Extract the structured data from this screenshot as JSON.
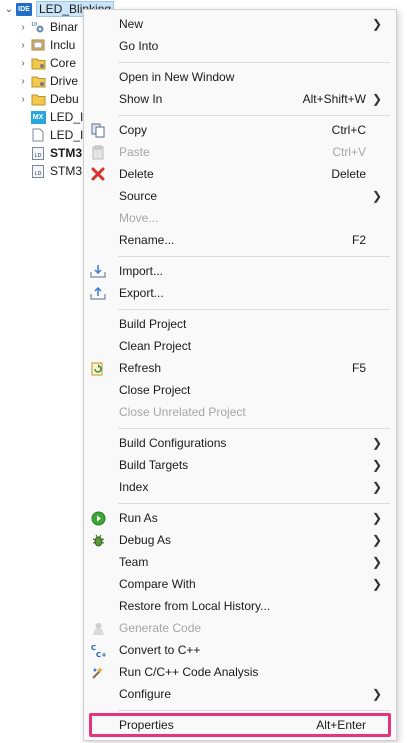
{
  "tree": {
    "items": [
      {
        "label": "LED_Blinking",
        "icon": "ide-project-icon",
        "expanded": true
      },
      {
        "label": "Binar",
        "icon": "binaries-icon"
      },
      {
        "label": "Inclu",
        "icon": "includes-icon"
      },
      {
        "label": "Core",
        "icon": "folder-icon"
      },
      {
        "label": "Drive",
        "icon": "folder-icon"
      },
      {
        "label": "Debu",
        "icon": "folder-icon"
      },
      {
        "label": "LED_I",
        "icon": "mx-file-icon"
      },
      {
        "label": "LED_I",
        "icon": "file-icon"
      },
      {
        "label": "STM3",
        "icon": "linker-file-icon"
      },
      {
        "label": "STM3",
        "icon": "linker-file-icon"
      }
    ]
  },
  "menu": {
    "items": [
      {
        "label": "New",
        "shortcut": "",
        "submenu": true
      },
      {
        "label": "Go Into",
        "shortcut": ""
      },
      {
        "label": "Open in New Window",
        "shortcut": ""
      },
      {
        "label": "Show In",
        "shortcut": "Alt+Shift+W",
        "submenu": true
      },
      {
        "label": "Copy",
        "shortcut": "Ctrl+C",
        "icon": "copy-icon"
      },
      {
        "label": "Paste",
        "shortcut": "Ctrl+V",
        "icon": "paste-icon",
        "disabled": true
      },
      {
        "label": "Delete",
        "shortcut": "Delete",
        "icon": "delete-icon"
      },
      {
        "label": "Source",
        "shortcut": "",
        "submenu": true
      },
      {
        "label": "Move...",
        "shortcut": "",
        "disabled": true
      },
      {
        "label": "Rename...",
        "shortcut": "F2"
      },
      {
        "label": "Import...",
        "shortcut": "",
        "icon": "import-icon"
      },
      {
        "label": "Export...",
        "shortcut": "",
        "icon": "export-icon"
      },
      {
        "label": "Build Project",
        "shortcut": ""
      },
      {
        "label": "Clean Project",
        "shortcut": ""
      },
      {
        "label": "Refresh",
        "shortcut": "F5",
        "icon": "refresh-icon"
      },
      {
        "label": "Close Project",
        "shortcut": ""
      },
      {
        "label": "Close Unrelated Project",
        "shortcut": "",
        "disabled": true
      },
      {
        "label": "Build Configurations",
        "shortcut": "",
        "submenu": true
      },
      {
        "label": "Build Targets",
        "shortcut": "",
        "submenu": true
      },
      {
        "label": "Index",
        "shortcut": "",
        "submenu": true
      },
      {
        "label": "Run As",
        "shortcut": "",
        "submenu": true,
        "icon": "run-icon"
      },
      {
        "label": "Debug As",
        "shortcut": "",
        "submenu": true,
        "icon": "debug-bug-icon"
      },
      {
        "label": "Team",
        "shortcut": "",
        "submenu": true
      },
      {
        "label": "Compare With",
        "shortcut": "",
        "submenu": true
      },
      {
        "label": "Restore from Local History...",
        "shortcut": ""
      },
      {
        "label": "Generate Code",
        "shortcut": "",
        "icon": "generate-code-icon",
        "disabled": true
      },
      {
        "label": "Convert to C++",
        "shortcut": "",
        "icon": "convert-cpp-icon"
      },
      {
        "label": "Run C/C++ Code Analysis",
        "shortcut": "",
        "icon": "code-analysis-icon"
      },
      {
        "label": "Configure",
        "shortcut": "",
        "submenu": true
      },
      {
        "label": "Properties",
        "shortcut": "Alt+Enter",
        "highlighted": true
      }
    ]
  },
  "colors": {
    "highlight_border": "#e6357d",
    "disabled_text": "#a6a6a6",
    "selection_bg": "#cce4f7"
  }
}
